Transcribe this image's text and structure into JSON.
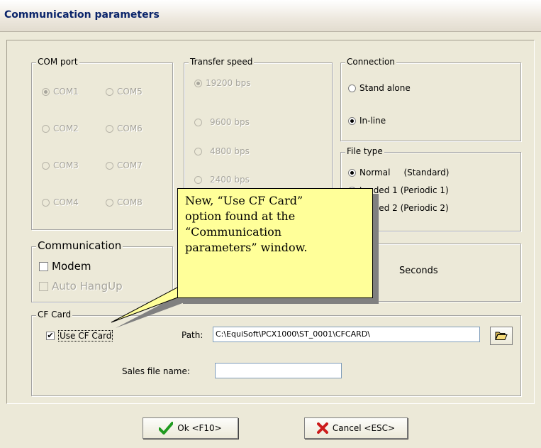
{
  "window": {
    "title": "Communication parameters"
  },
  "com_port": {
    "legend": "COM port",
    "options": [
      "COM1",
      "COM5",
      "COM2",
      "COM6",
      "COM3",
      "COM7",
      "COM4",
      "COM8"
    ],
    "selected": "COM1"
  },
  "transfer_speed": {
    "legend": "Transfer speed",
    "options": [
      "19200 bps",
      "9600 bps",
      "4800 bps",
      "2400 bps"
    ],
    "selected": "19200 bps"
  },
  "connection": {
    "legend": "Connection",
    "options": [
      "Stand alone",
      "In-line"
    ],
    "selected": "In-line"
  },
  "file_type": {
    "legend": "File type",
    "options": [
      "Normal     (Standard)",
      "Extended 1 (Periodic 1)",
      "Extended 2 (Periodic 2)"
    ],
    "visible_labels": [
      "Normal     (Standard)",
      "tended 1 (Periodic 1)",
      "tended 2 (Periodic 2)"
    ],
    "selected": "Normal     (Standard)"
  },
  "timeout": {
    "unit": "Seconds"
  },
  "communication": {
    "legend": "Communication",
    "modem_label": "Modem",
    "modem_checked": false,
    "auto_hangup_label": "Auto HangUp",
    "auto_hangup_checked": false
  },
  "cf_card": {
    "legend": "CF Card",
    "use_label": "Use CF Card",
    "use_checked": true,
    "path_label": "Path:",
    "path_value": "C:\\EquiSoft\\PCX1000\\ST_0001\\CFCARD\\",
    "sales_label": "Sales file name:",
    "sales_value": ""
  },
  "buttons": {
    "ok": "Ok <F10>",
    "cancel": "Cancel <ESC>"
  },
  "icons": {
    "ok": "checkmark-icon",
    "cancel": "x-icon",
    "browse": "folder-open-icon"
  },
  "callout": {
    "lines": [
      "New, “Use CF Card”",
      "option found at the",
      "“Communication",
      "parameters” window."
    ]
  },
  "colors": {
    "callout_bg": "#ffff99",
    "ok_check": "#1f9a1f",
    "cancel_x": "#cc1b1b"
  }
}
